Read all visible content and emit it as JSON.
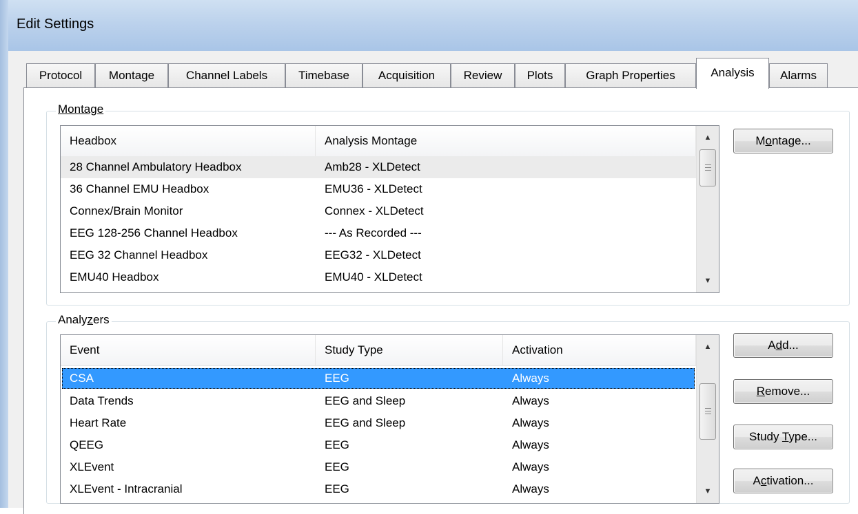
{
  "window": {
    "title": "Edit Settings"
  },
  "tabs": [
    {
      "label": "Protocol"
    },
    {
      "label": "Montage"
    },
    {
      "label": "Channel Labels"
    },
    {
      "label": "Timebase"
    },
    {
      "label": "Acquisition"
    },
    {
      "label": "Review"
    },
    {
      "label": "Plots"
    },
    {
      "label": "Graph Properties"
    },
    {
      "label": "Analysis",
      "active": true
    },
    {
      "label": "Alarms"
    }
  ],
  "montage": {
    "group_label": "Montage",
    "columns": [
      "Headbox",
      "Analysis Montage"
    ],
    "rows": [
      [
        "28 Channel Ambulatory Headbox",
        "Amb28 - XLDetect"
      ],
      [
        "36 Channel EMU Headbox",
        "EMU36 - XLDetect"
      ],
      [
        "Connex/Brain Monitor",
        "Connex - XLDetect"
      ],
      [
        "EEG 128-256 Channel Headbox",
        "--- As Recorded ---"
      ],
      [
        "EEG 32 Channel Headbox",
        "EEG32 - XLDetect"
      ],
      [
        "EMU40 Headbox",
        "EMU40 - XLDetect"
      ]
    ],
    "hover_row": 0,
    "button": "Montage..."
  },
  "analyzers": {
    "group_label": "Analyzers",
    "columns": [
      "Event",
      "Study Type",
      "Activation"
    ],
    "rows": [
      [
        "CSA",
        "EEG",
        "Always"
      ],
      [
        "Data Trends",
        "EEG and Sleep",
        "Always"
      ],
      [
        "Heart Rate",
        "EEG and Sleep",
        "Always"
      ],
      [
        "QEEG",
        "EEG",
        "Always"
      ],
      [
        "XLEvent",
        "EEG",
        "Always"
      ],
      [
        "XLEvent - Intracranial",
        "EEG",
        "Always"
      ]
    ],
    "selected_row": 0,
    "buttons": {
      "add": "Add...",
      "remove": "Remove...",
      "study_type": "Study Type...",
      "activation": "Activation..."
    }
  },
  "colors": {
    "selection": "#3399ff",
    "titlebar": "#bcd2ec"
  }
}
